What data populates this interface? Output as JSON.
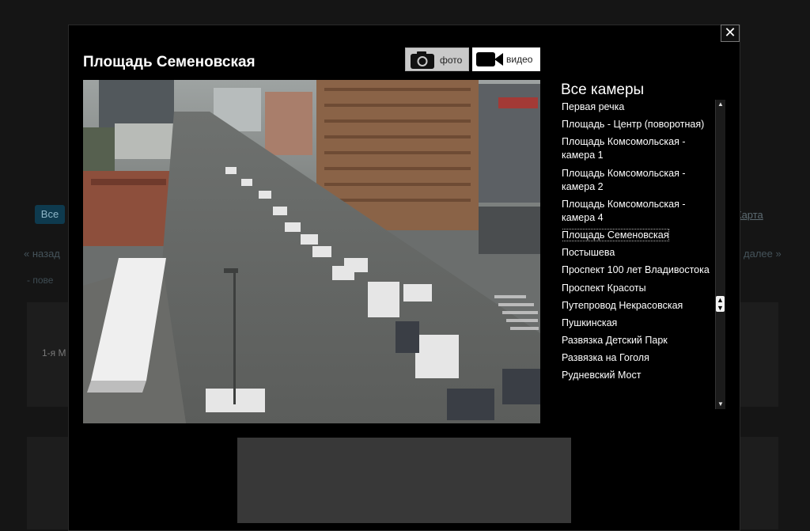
{
  "background": {
    "all_button": "Все",
    "map_link": "Карта",
    "back_link": "« назад",
    "next_link": "далее »",
    "search_text": "- пове",
    "card_text": "1-я М"
  },
  "modal": {
    "title": "Площадь Семеновская",
    "close_label": "✕",
    "modes": {
      "photo_label": "фото",
      "video_label": "видео",
      "selected": "видео"
    },
    "camera_list": {
      "heading": "Все камеры",
      "items": [
        "Первая речка",
        "Площадь - Центр (поворотная)",
        "Площадь Комсомольская - камера 1",
        "Площадь Комсомольская - камера 2",
        "Площадь Комсомольская - камера 4",
        "Площадь Семеновская",
        "Постышева",
        "Проспект 100 лет Владивостока",
        "Проспект Красоты",
        "Путепровод Некрасовская",
        "Пушкинская",
        "Развязка Детский Парк",
        "Развязка на Гоголя",
        "Рудневский Мост"
      ],
      "selected": "Площадь Семеновская"
    }
  },
  "icons": {
    "photo": "camera-icon",
    "video": "video-camera-icon",
    "close": "close-icon"
  },
  "colors": {
    "modal_bg": "#000000",
    "photo_btn_bg": "#c9c9c9",
    "video_btn_bg": "#ffffff",
    "accent_all_btn": "#0e3a4e"
  }
}
